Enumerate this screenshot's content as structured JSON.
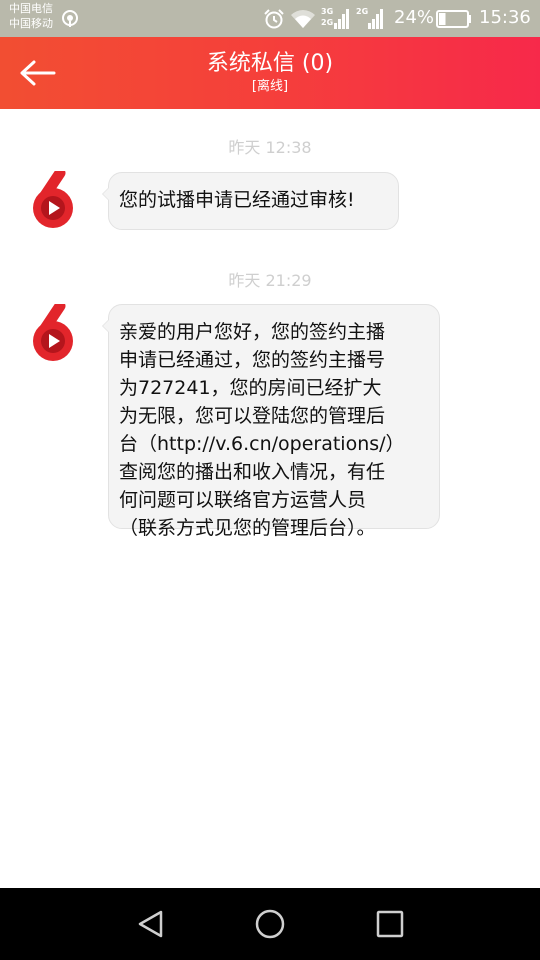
{
  "status_bar": {
    "carrier_1": "中国电信",
    "carrier_2": "中国移动",
    "network_3g": "3G",
    "network_2g_a": "2G",
    "network_2g_b": "2G",
    "battery_percent": "24%",
    "time": "15:36",
    "battery_level": 0.24,
    "icons": [
      "hotspot-icon",
      "alarm-icon",
      "wifi-icon",
      "signal-icon",
      "signal-icon",
      "battery-icon"
    ]
  },
  "header": {
    "title": "系统私信 (0)",
    "subtitle": "[离线]",
    "back_icon": "back-arrow-icon"
  },
  "messages": [
    {
      "time": "昨天 12:38",
      "text": "您的试播申请已经通过审核!"
    },
    {
      "time": "昨天 21:29",
      "text": "亲爱的用户您好，您的签约主播\n申请已经通过，您的签约主播号\n为727241，您的房间已经扩大\n为无限，您可以登陆您的管理后\n台（http://v.6.cn/operations/）\n查阅您的播出和收入情况，有任\n何问题可以联络官方运营人员\n（联系方式见您的管理后台）。"
    }
  ],
  "avatar": {
    "brand_glyph": "6",
    "color_outer": "#e2252b",
    "color_dark": "#b4151c"
  },
  "nav_bar": {
    "icons": [
      "back-triangle-icon",
      "home-circle-icon",
      "recents-square-icon"
    ]
  }
}
